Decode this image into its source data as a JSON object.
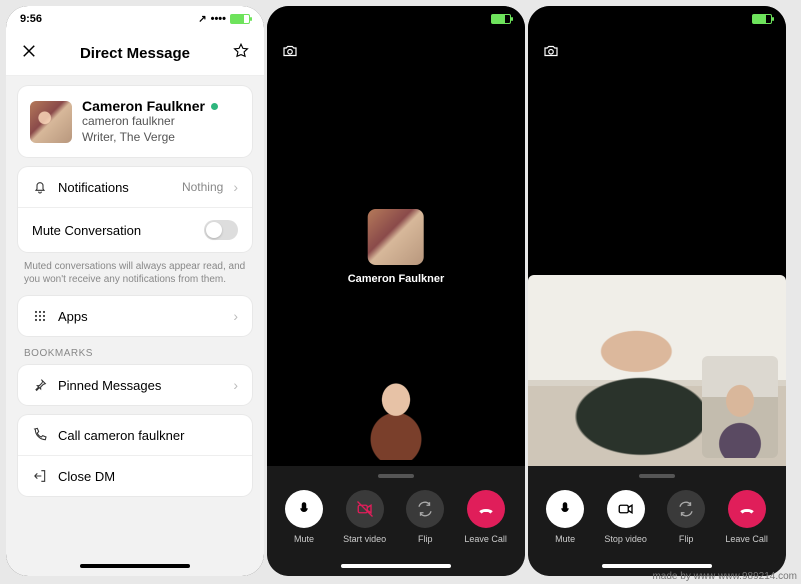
{
  "panel1": {
    "status_time": "9:56",
    "header_title": "Direct Message",
    "profile": {
      "name": "Cameron Faulkner",
      "handle": "cameron faulkner",
      "role": "Writer, The Verge"
    },
    "rows": {
      "notifications_label": "Notifications",
      "notifications_value": "Nothing",
      "mute_label": "Mute Conversation",
      "muted_help": "Muted conversations will always appear read, and you won't receive any notifications from them.",
      "apps_label": "Apps",
      "bookmarks_header": "BOOKMARKS",
      "pinned_label": "Pinned Messages",
      "call_label": "Call cameron faulkner",
      "close_label": "Close DM"
    }
  },
  "panel2": {
    "caller_name": "Cameron Faulkner",
    "buttons": {
      "mute": "Mute",
      "video": "Start video",
      "flip": "Flip",
      "leave": "Leave Call"
    }
  },
  "panel3": {
    "buttons": {
      "mute": "Mute",
      "video": "Stop video",
      "flip": "Flip",
      "leave": "Leave Call"
    }
  },
  "watermark_left": "made by www",
  "watermark_right": "www.989214.com"
}
